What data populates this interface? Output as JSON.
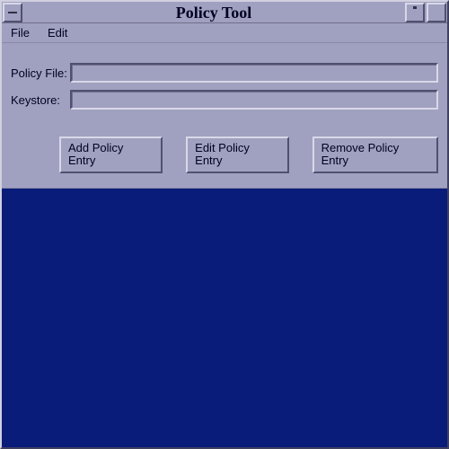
{
  "window": {
    "title": "Policy Tool"
  },
  "menubar": {
    "file": "File",
    "edit": "Edit"
  },
  "form": {
    "policy_file_label": "Policy File:",
    "policy_file_value": "",
    "keystore_label": "Keystore:",
    "keystore_value": ""
  },
  "buttons": {
    "add": "Add Policy Entry",
    "edit": "Edit Policy Entry",
    "remove": "Remove Policy Entry"
  },
  "colors": {
    "panel": "#a0a0c0",
    "list_bg": "#0a1c7a"
  }
}
